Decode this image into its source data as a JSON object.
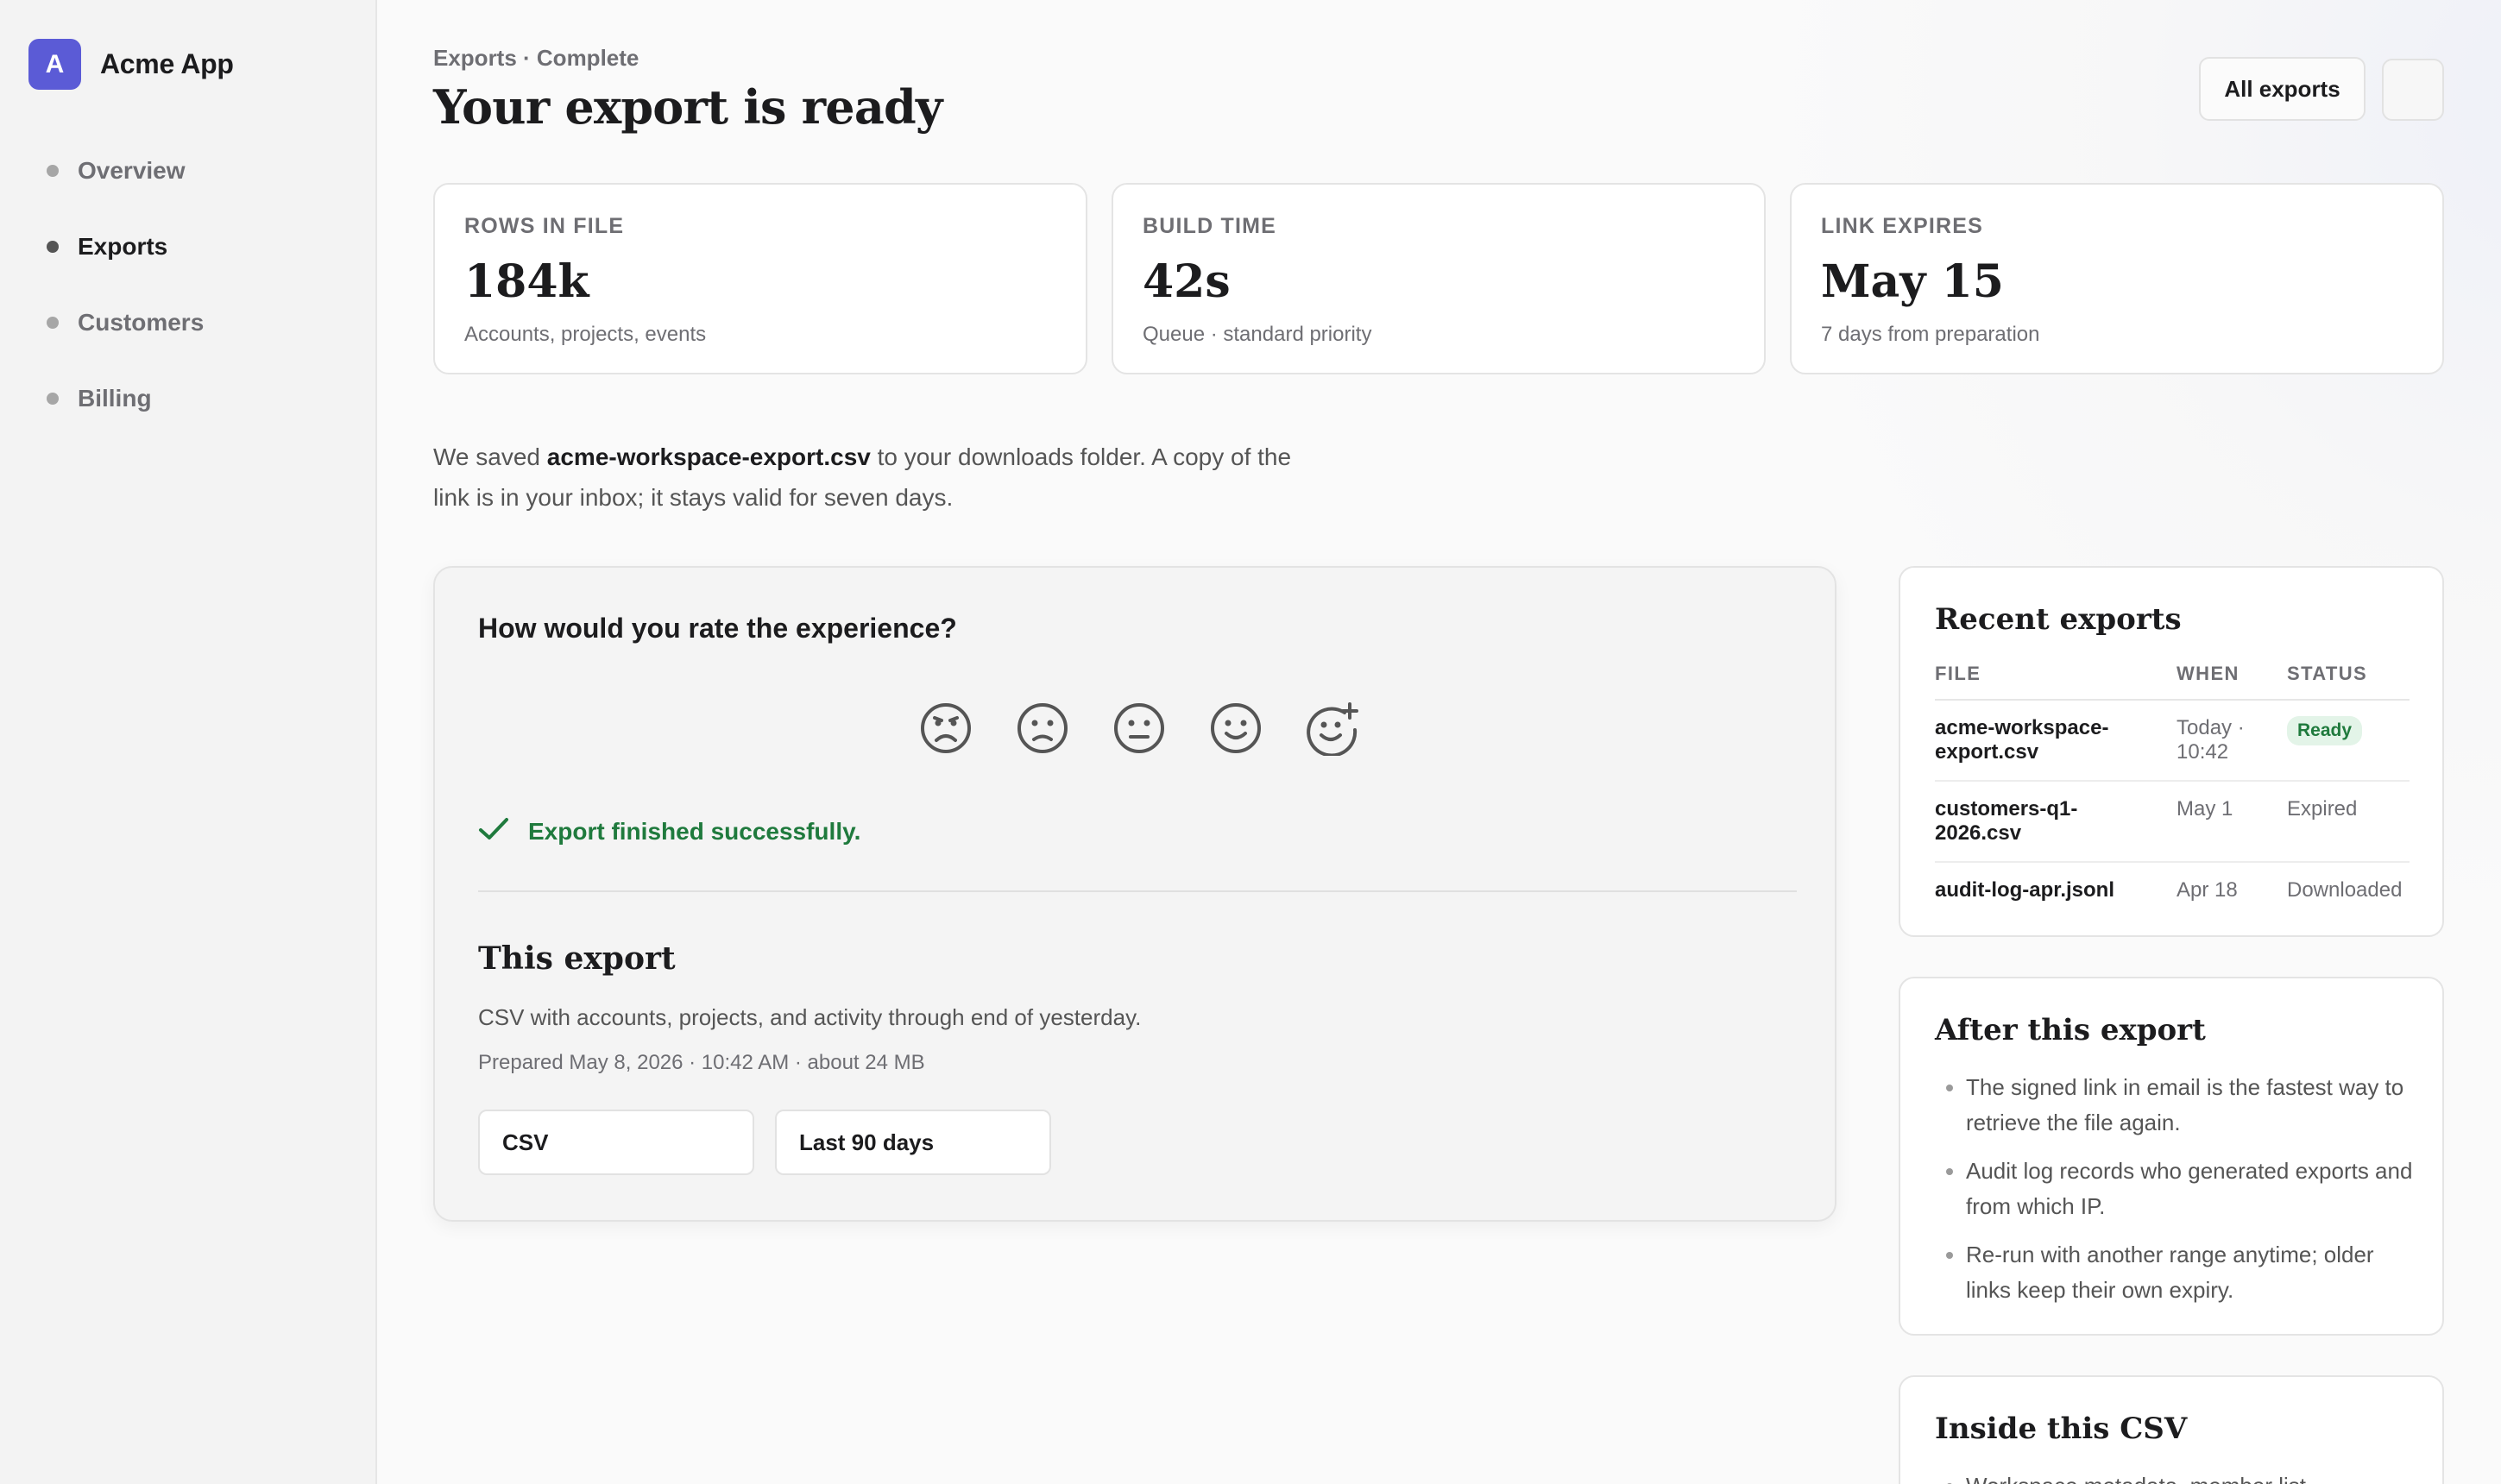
{
  "app": {
    "logo_letter": "A",
    "name": "Acme App"
  },
  "sidebar": {
    "items": [
      {
        "label": "Overview",
        "active": false
      },
      {
        "label": "Exports",
        "active": true
      },
      {
        "label": "Customers",
        "active": false
      },
      {
        "label": "Billing",
        "active": false
      }
    ]
  },
  "header": {
    "breadcrumb": "Exports · Complete",
    "title": "Your export is ready",
    "all_exports_label": "All exports"
  },
  "stats": [
    {
      "label": "ROWS IN FILE",
      "value": "184k",
      "sub": "Accounts, projects, events"
    },
    {
      "label": "BUILD TIME",
      "value": "42s",
      "sub": "Queue · standard priority"
    },
    {
      "label": "LINK EXPIRES",
      "value": "May 15",
      "sub": "7 days from preparation"
    }
  ],
  "intro": {
    "before": "We saved ",
    "filename": "acme-workspace-export.csv",
    "after": " to your downloads folder. A copy of the link is in your inbox; it stays valid for seven days."
  },
  "feedback": {
    "question": "How would you rate the experience?",
    "faces": [
      "very-sad-face-icon",
      "sad-face-icon",
      "neutral-face-icon",
      "happy-face-icon",
      "add-reaction-face-icon"
    ],
    "success_message": "Export finished successfully.",
    "success_color": "#1f7a3d"
  },
  "this_export": {
    "title": "This export",
    "description": "CSV with accounts, projects, and activity through end of yesterday.",
    "meta": "Prepared May 8, 2026 · 10:42 AM · about 24 MB",
    "format": "CSV",
    "range": "Last 90 days"
  },
  "recent_exports": {
    "title": "Recent exports",
    "columns": [
      "FILE",
      "WHEN",
      "STATUS"
    ],
    "rows": [
      {
        "file": "acme-workspace-export.csv",
        "when": "Today · 10:42",
        "status": "Ready"
      },
      {
        "file": "customers-q1-2026.csv",
        "when": "May 1",
        "status": "Expired"
      },
      {
        "file": "audit-log-apr.jsonl",
        "when": "Apr 18",
        "status": "Downloaded"
      }
    ]
  },
  "after_export": {
    "title": "After this export",
    "items": [
      "The signed link in email is the fastest way to retrieve the file again.",
      "Audit log records who generated exports and from which IP.",
      "Re-run with another range anytime; older links keep their own expiry."
    ]
  },
  "inside_csv": {
    "title": "Inside this CSV",
    "items": [
      "Workspace metadata, member list"
    ]
  },
  "colors": {
    "brand": "#5b5bd6",
    "success": "#1f7a3d",
    "badge_bg": "#e3f4e8"
  }
}
